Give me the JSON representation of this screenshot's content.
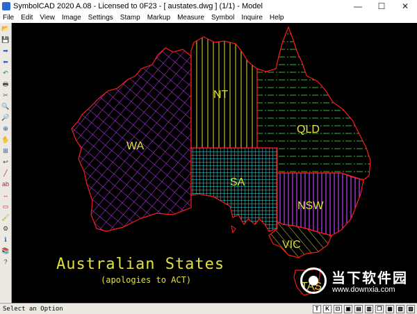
{
  "window": {
    "title": "SymbolCAD 2020 A.08 - Licensed to 0F23   -  [ austates.dwg ] (1/1)  -  Model",
    "controls": {
      "minimize": "—",
      "maximize": "☐",
      "close": "✕"
    }
  },
  "menu": [
    "File",
    "Edit",
    "View",
    "Image",
    "Settings",
    "Stamp",
    "Markup",
    "Measure",
    "Symbol",
    "Inquire",
    "Help"
  ],
  "toolbar": {
    "icons": [
      "open-folder-icon",
      "save-icon",
      "arrow-right-icon",
      "arrow-left-icon",
      "undo-icon",
      "print-icon",
      "cut-icon",
      "zoom-in-icon",
      "zoom-out-icon",
      "zoom-window-icon",
      "pan-icon",
      "zoom-all-icon",
      "undo-arrow-icon",
      "line-icon",
      "text-icon",
      "dimension-icon",
      "rectangle-icon",
      "brush-icon",
      "settings-icon",
      "info-icon",
      "books-icon",
      "help-icon"
    ],
    "glyphs": [
      "📂",
      "💾",
      "➡",
      "⬅",
      "↶",
      "🖶",
      "✂",
      "🔍",
      "🔎",
      "⊕",
      "✋",
      "⊞",
      "↩",
      "╱",
      "ab",
      "↔",
      "▭",
      "🖌",
      "⚙",
      "ℹ",
      "📚",
      "?"
    ],
    "colors": [
      "#c8a040",
      "#3050a0",
      "#2060c0",
      "#2060c0",
      "#208040",
      "#404040",
      "#606060",
      "#2050a0",
      "#2050a0",
      "#2050a0",
      "#a06020",
      "#2050a0",
      "#404040",
      "#c02020",
      "#c02020",
      "#c02020",
      "#c02020",
      "#c0a000",
      "#404040",
      "#2060c0",
      "#a03030",
      "#206020"
    ]
  },
  "map": {
    "states": {
      "WA": "WA",
      "NT": "NT",
      "QLD": "QLD",
      "SA": "SA",
      "NSW": "NSW",
      "VIC": "VIC",
      "TAS": "TAS"
    },
    "title": "Australian States",
    "subtitle": "(apologies to ACT)",
    "colors": {
      "outline": "#ff1a1a",
      "wa": "#c040ff",
      "nt": "#e0e040",
      "qld": "#30c030",
      "sa": "#30e0e0",
      "nsw": "#c040ff",
      "vic": "#e0e040",
      "title": "#e0e040"
    }
  },
  "status": {
    "text": "Select an Option",
    "buttons": [
      "T",
      "K",
      "⊡",
      "▣",
      "▤",
      "▥",
      "❐",
      "▦",
      "▧",
      "▨"
    ]
  },
  "watermark": {
    "name": "当下软件园",
    "url": "www.downxia.com"
  }
}
